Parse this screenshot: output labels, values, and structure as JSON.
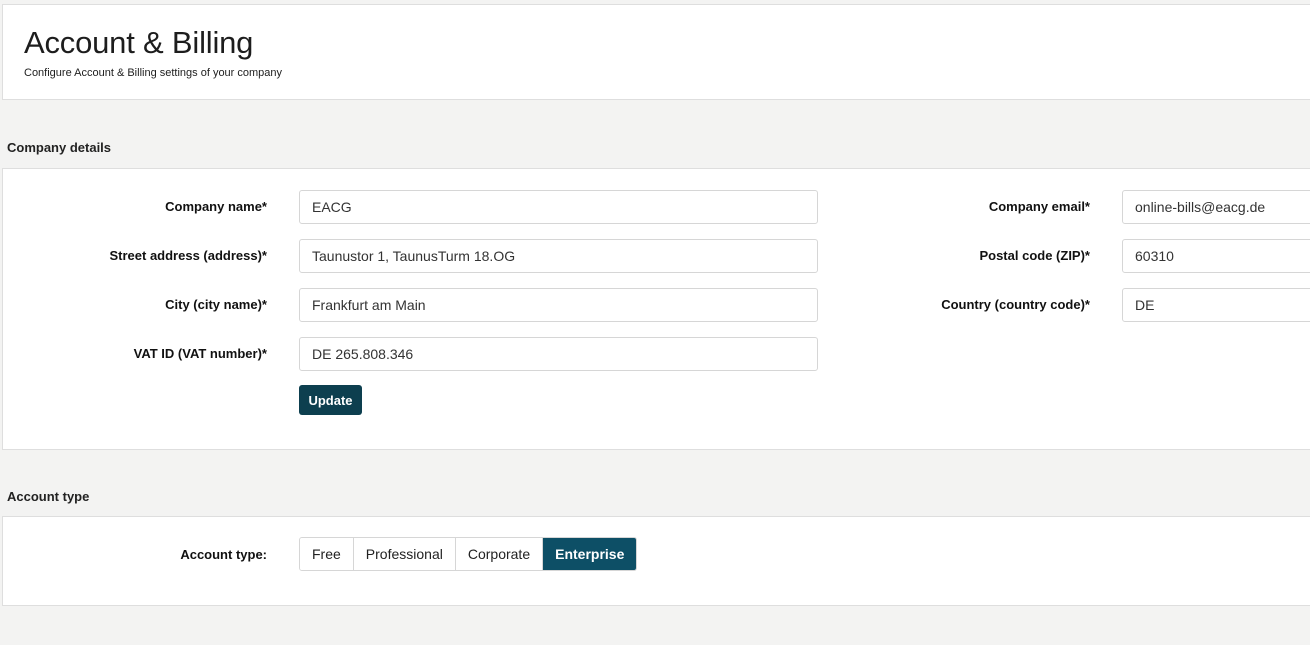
{
  "header": {
    "title": "Account & Billing",
    "subtitle": "Configure Account & Billing settings of your company"
  },
  "company_details": {
    "section_title": "Company details",
    "fields": {
      "company_name": {
        "label": "Company name*",
        "value": "EACG"
      },
      "street_address": {
        "label": "Street address (address)*",
        "value": "Taunustor 1, TaunusTurm 18.OG"
      },
      "city": {
        "label": "City (city name)*",
        "value": "Frankfurt am Main"
      },
      "vat_id": {
        "label": "VAT ID (VAT number)*",
        "value": "DE 265.808.346"
      },
      "company_email": {
        "label": "Company email*",
        "value": "online-bills@eacg.de"
      },
      "postal_code": {
        "label": "Postal code (ZIP)*",
        "value": "60310"
      },
      "country": {
        "label": "Country (country code)*",
        "value": "DE"
      }
    },
    "update_label": "Update",
    "update_button_color": "#0d3f4f"
  },
  "account_type": {
    "section_title": "Account type",
    "label": "Account type:",
    "options": [
      "Free",
      "Professional",
      "Corporate",
      "Enterprise"
    ],
    "selected": "Enterprise",
    "active_color": "#0d4f66"
  }
}
